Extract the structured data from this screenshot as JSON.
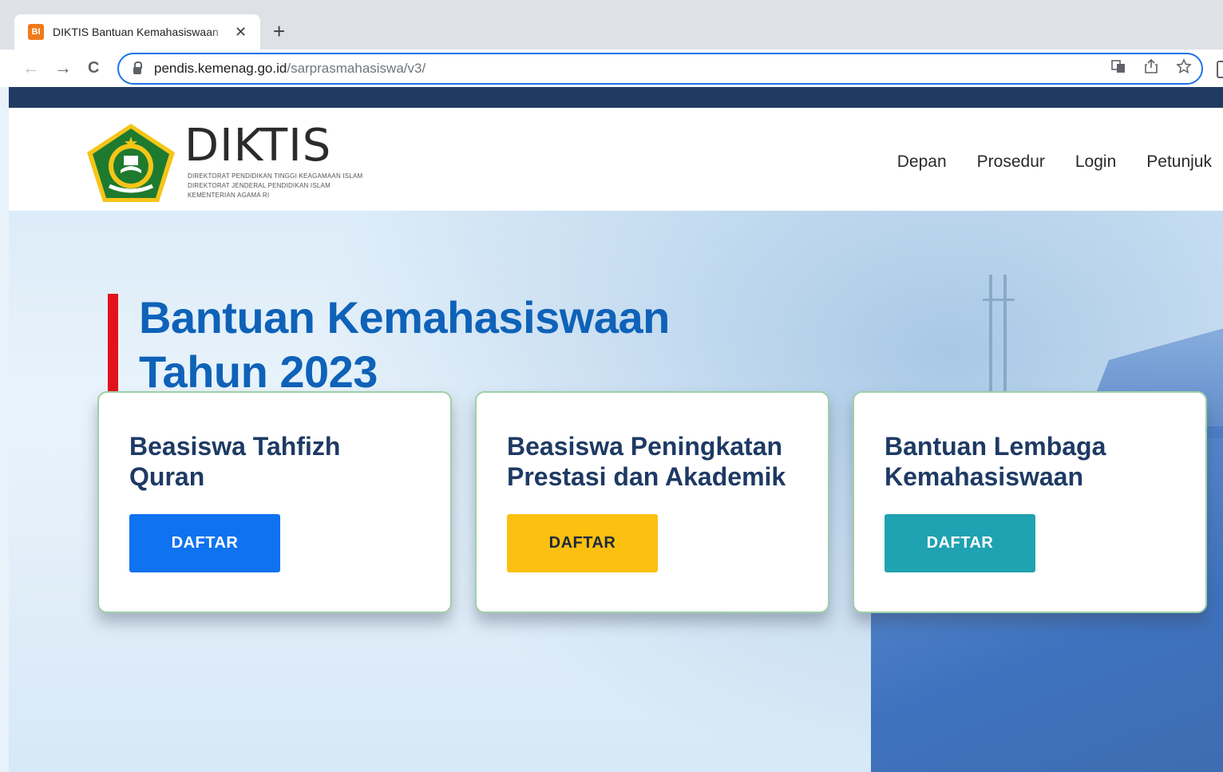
{
  "browser": {
    "tab_favicon": "BI",
    "tab_title": "DIKTIS Bantuan Kemahasiswaan",
    "tab_close": "✕",
    "new_tab": "+",
    "back": "←",
    "forward": "→",
    "reload": "C",
    "url_host": "pendis.kemenag.go.id",
    "url_path": "/sarprasmahasiswa/v3/",
    "icons": [
      "translate-icon",
      "share-icon",
      "star-icon"
    ]
  },
  "header": {
    "logo_text": "DIKTIS",
    "logo_sub_1": "DIREKTORAT PENDIDIKAN TINGGI KEAGAMAAN ISLAM",
    "logo_sub_2": "DIREKTORAT JENDERAL PENDIDIKAN ISLAM",
    "logo_sub_3": "KEMENTERIAN AGAMA RI",
    "nav": [
      "Depan",
      "Prosedur",
      "Login",
      "Petunjuk"
    ]
  },
  "hero": {
    "title_line_1": "Bantuan Kemahasiswaan",
    "title_line_2": "Tahun 2023",
    "accent_color": "#e3131b",
    "title_color": "#0e62b8"
  },
  "cards": [
    {
      "title_line_1": "Beasiswa Tahfizh",
      "title_line_2": "Quran",
      "button": "DAFTAR",
      "button_color": "#0f72f0"
    },
    {
      "title_line_1": "Beasiswa Peningkatan",
      "title_line_2": "Prestasi dan Akademik",
      "button": "DAFTAR",
      "button_color": "#fcc010"
    },
    {
      "title_line_1": "Bantuan Lembaga",
      "title_line_2": "Kemahasiswaan",
      "button": "DAFTAR",
      "button_color": "#1fa2b1"
    }
  ]
}
